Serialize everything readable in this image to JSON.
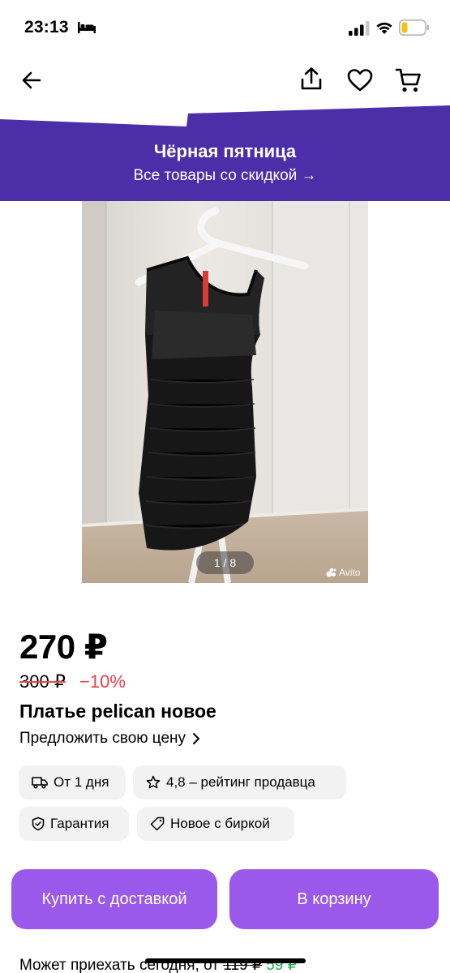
{
  "status": {
    "time": "23:13"
  },
  "promo": {
    "title": "Чёрная пятница",
    "subtitle": "Все товары со скидкой →",
    "color": "#4b2ea8"
  },
  "gallery": {
    "counter": "1 / 8",
    "watermark": "Avito"
  },
  "product": {
    "price": "270 ₽",
    "old_price": "300 ₽",
    "discount": "−10%",
    "title": "Платье pelican новое",
    "offer_label": "Предложить свою цену"
  },
  "chips": {
    "delivery": "От 1 дня",
    "rating": "4,8 – рейтинг продавца",
    "guarantee": "Гарантия",
    "condition": "Новое с биркой"
  },
  "buttons": {
    "buy": "Купить с доставкой",
    "cart": "В корзину",
    "accent": "#9a59ea"
  },
  "delivery_info": {
    "prefix": "Может приехать сегодня, от ",
    "old": "119 ₽",
    "new": " 59 ₽"
  }
}
